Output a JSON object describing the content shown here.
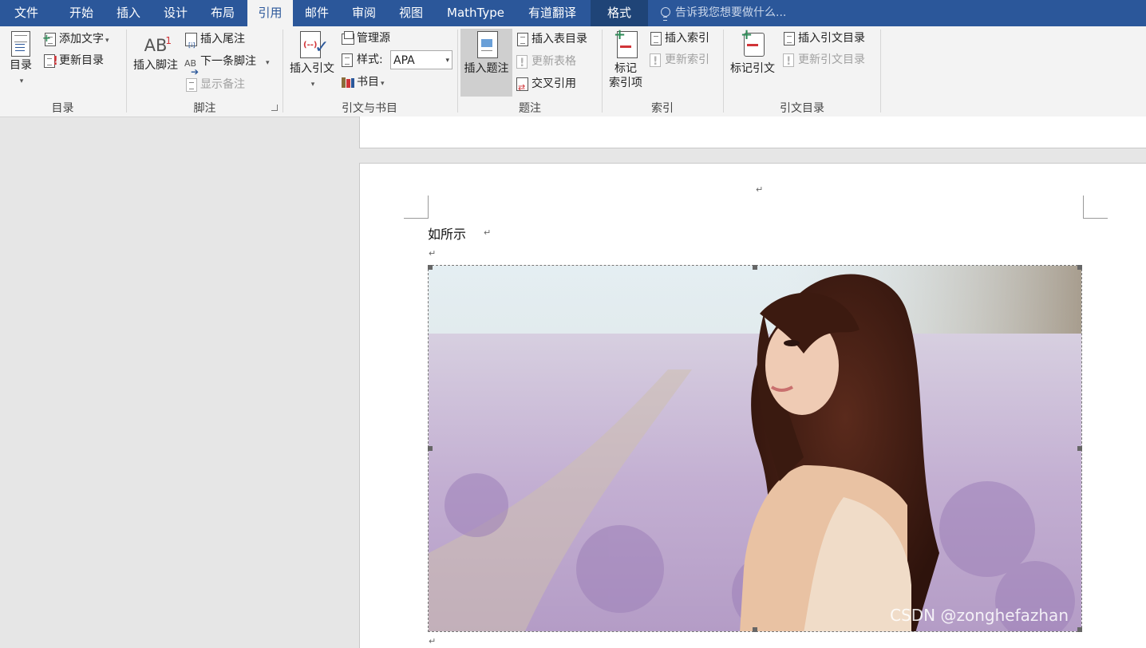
{
  "tabs": {
    "file": "文件",
    "home": "开始",
    "insert": "插入",
    "design": "设计",
    "layout": "布局",
    "references": "引用",
    "mailings": "邮件",
    "review": "审阅",
    "view": "视图",
    "mathtype": "MathType",
    "youdao": "有道翻译",
    "format": "格式"
  },
  "tellme": {
    "placeholder": "告诉我您想要做什么..."
  },
  "toc": {
    "toc_button": "目录",
    "add_text": "添加文字",
    "update_table": "更新目录",
    "group": "目录"
  },
  "footnotes": {
    "insert_footnote": "插入脚注",
    "insert_endnote": "插入尾注",
    "next_footnote": "下一条脚注",
    "show_notes": "显示备注",
    "group": "脚注"
  },
  "citations": {
    "insert_citation": "插入引文",
    "manage_sources": "管理源",
    "style_label": "样式:",
    "style_value": "APA",
    "bibliography": "书目",
    "group": "引文与书目"
  },
  "captions": {
    "insert_caption": "插入题注",
    "insert_table_of_figures": "插入表目录",
    "update_table": "更新表格",
    "cross_reference": "交叉引用",
    "group": "题注"
  },
  "index": {
    "mark_entry_1": "标记",
    "mark_entry_2": "索引项",
    "insert_index": "插入索引",
    "update_index": "更新索引",
    "group": "索引"
  },
  "toa": {
    "mark_citation": "标记引文",
    "insert_toa": "插入引文目录",
    "update_toa": "更新引文目录",
    "group": "引文目录"
  },
  "document": {
    "body_text": "如所示",
    "paragraph_mark": "↵"
  },
  "watermark": "CSDN @zonghefazhan",
  "colors": {
    "tabbar": "#2b579a",
    "ribbon": "#f3f3f3",
    "accent_red": "#d13438",
    "canvas": "#e6e6e6"
  }
}
